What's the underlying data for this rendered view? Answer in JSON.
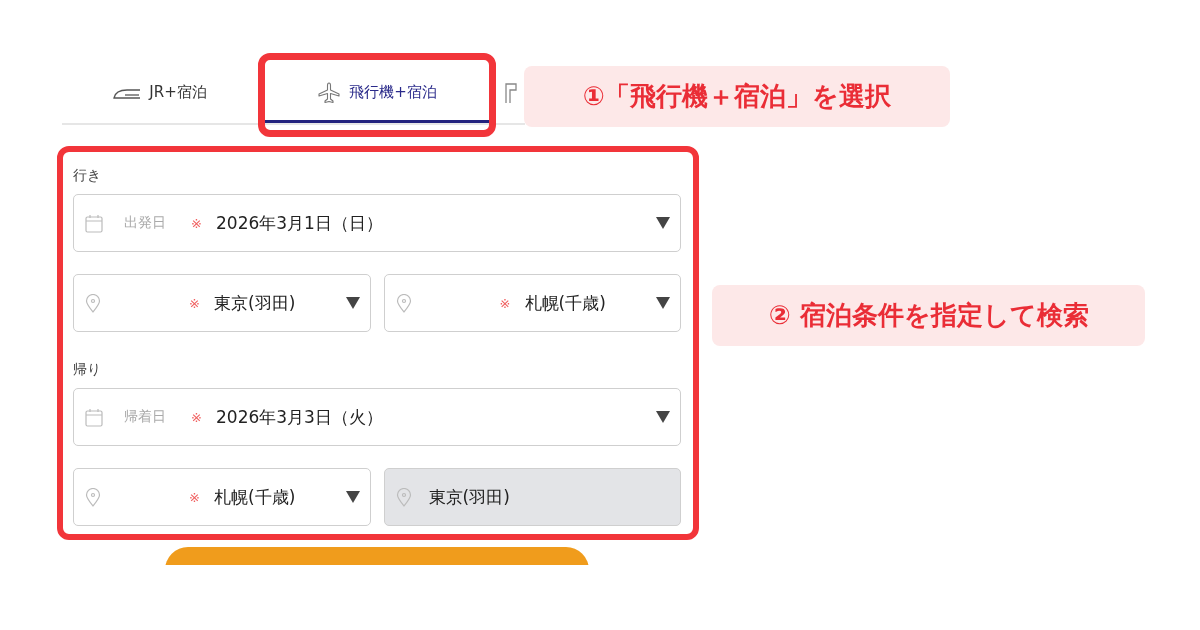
{
  "tabs": [
    {
      "kind": "train",
      "label": "JR+宿泊",
      "selected": false
    },
    {
      "kind": "plane",
      "label": "飛行機+宿泊",
      "selected": true
    },
    {
      "kind": "other",
      "selected": false
    }
  ],
  "annotations": [
    {
      "text": "①「飛行機＋宿泊」を選択"
    },
    {
      "text": "② 宿泊条件を指定して検索"
    }
  ],
  "form": {
    "sections": [
      {
        "label": "行き",
        "date": {
          "label": "出発日",
          "mark": "※",
          "value": "2026年3月1日（日）"
        },
        "places": [
          {
            "mark": "※",
            "value": "東京(羽田)",
            "disabled": false
          },
          {
            "mark": "※",
            "value": "札幌(千歳)",
            "disabled": false
          }
        ]
      },
      {
        "label": "帰り",
        "date": {
          "label": "帰着日",
          "mark": "※",
          "value": "2026年3月3日（火）"
        },
        "places": [
          {
            "mark": "※",
            "value": "札幌(千歳)",
            "disabled": false
          },
          {
            "value": "東京(羽田)",
            "disabled": true
          }
        ]
      }
    ]
  }
}
